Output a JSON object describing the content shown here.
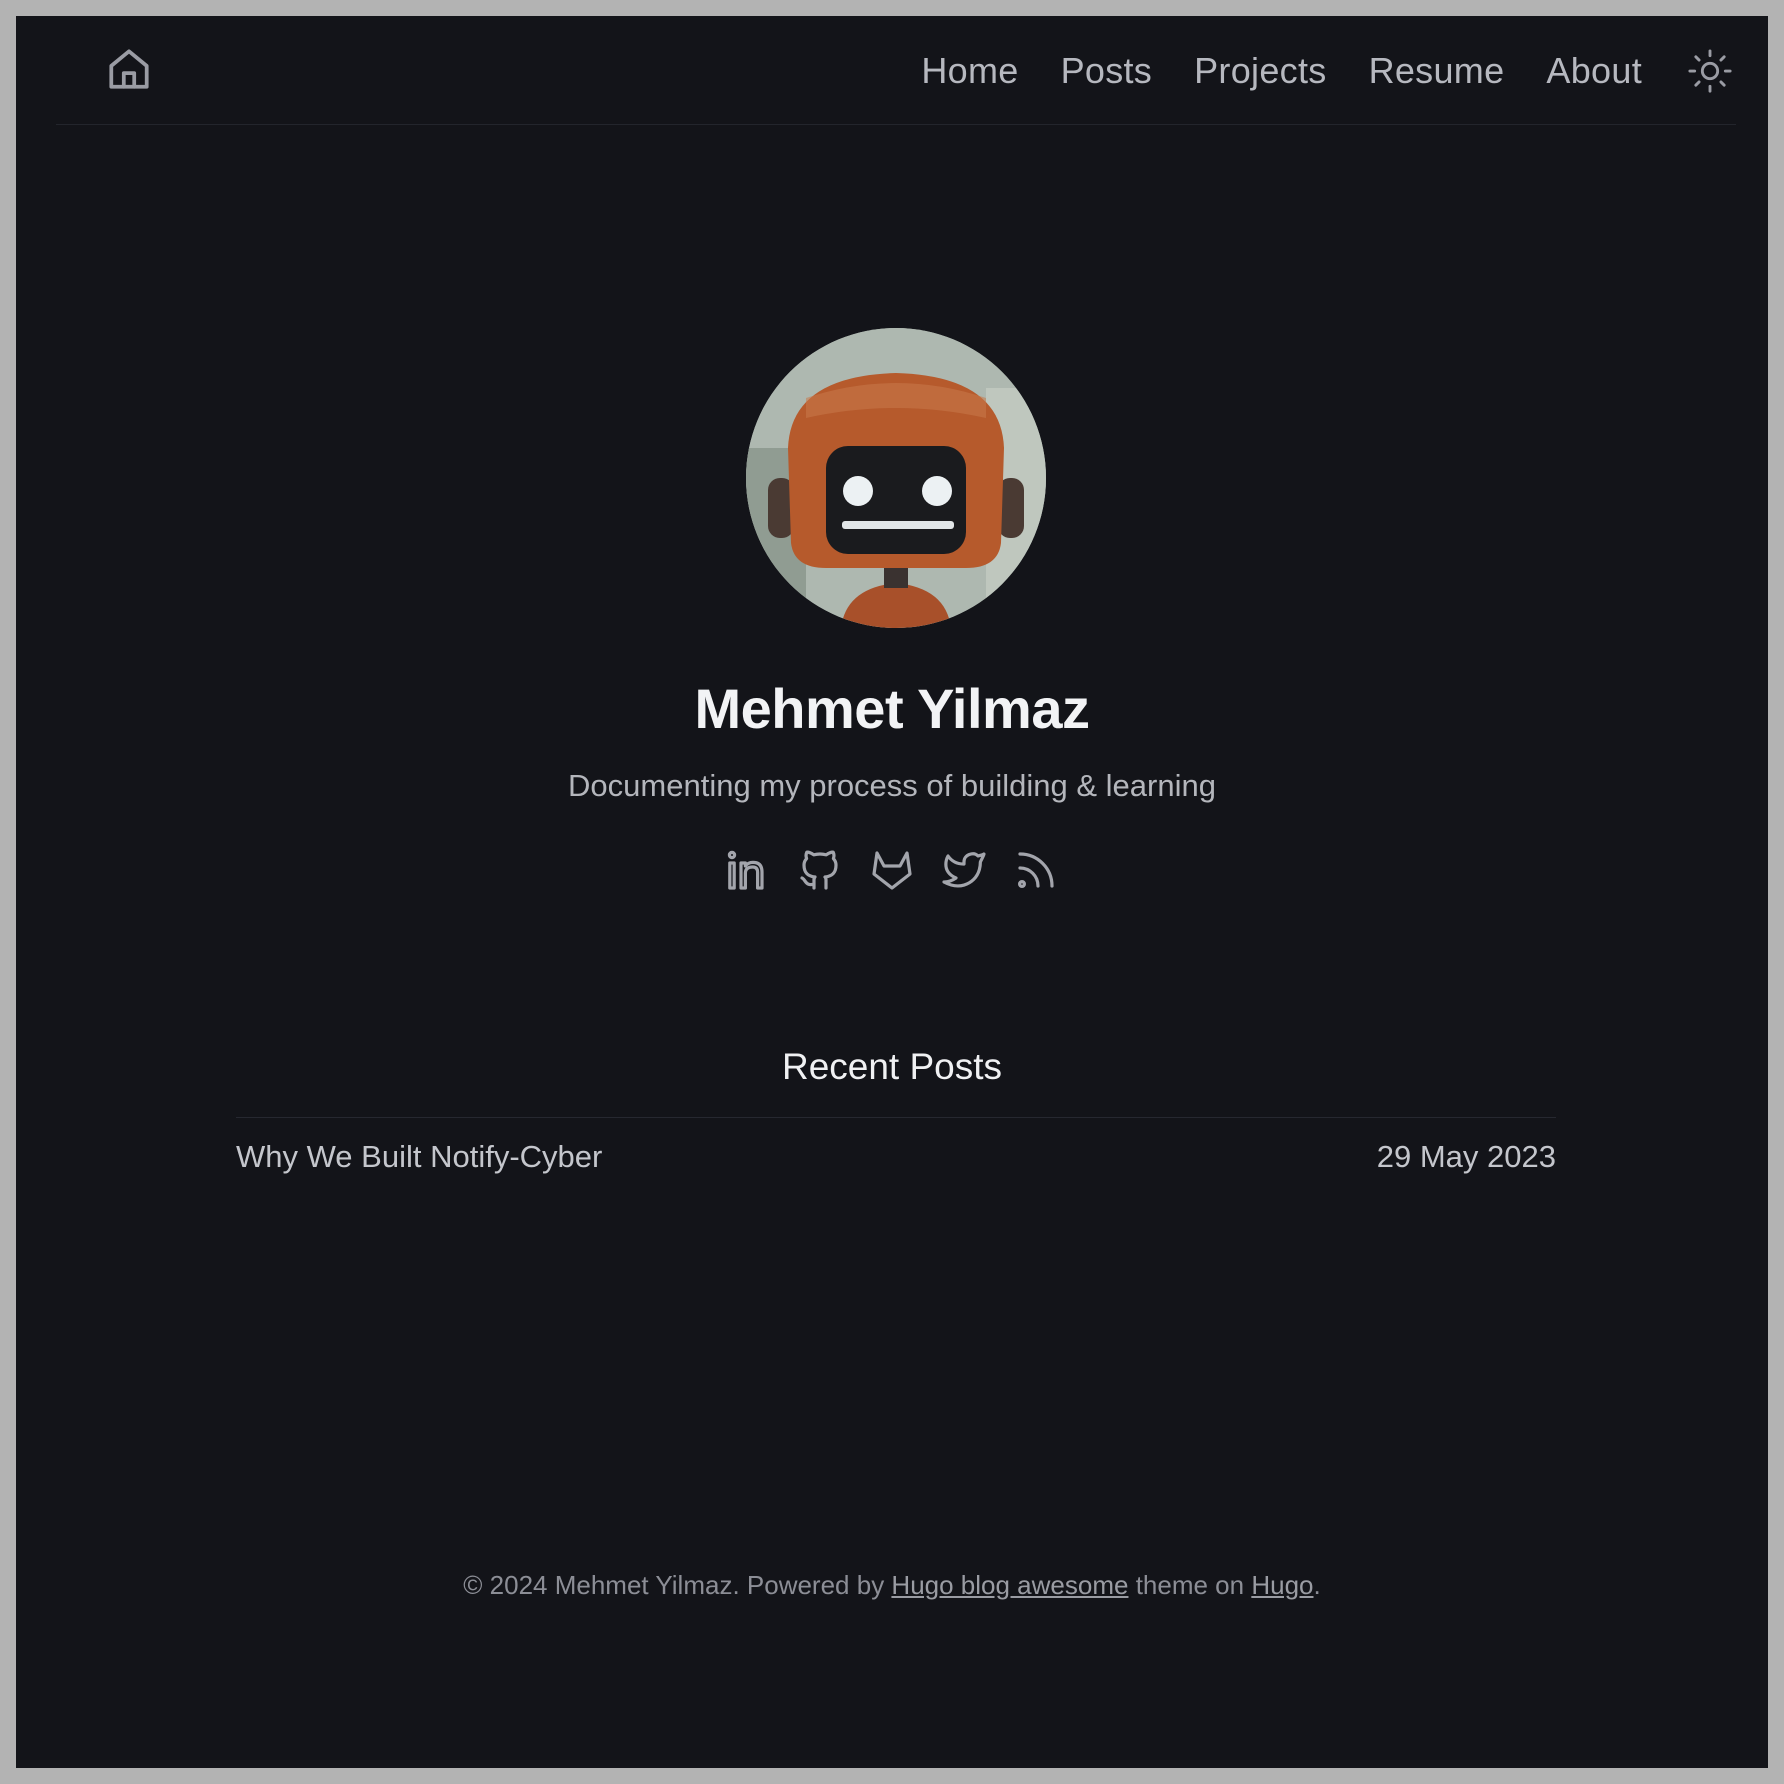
{
  "header": {
    "nav": [
      {
        "label": "Home"
      },
      {
        "label": "Posts"
      },
      {
        "label": "Projects"
      },
      {
        "label": "Resume"
      },
      {
        "label": "About"
      }
    ],
    "home_icon": "home-icon",
    "theme_icon": "sun-icon"
  },
  "hero": {
    "name": "Mehmet Yilmaz",
    "tagline": "Documenting my process of building & learning",
    "socials": [
      {
        "icon": "linkedin-icon"
      },
      {
        "icon": "github-icon"
      },
      {
        "icon": "gitlab-icon"
      },
      {
        "icon": "twitter-icon"
      },
      {
        "icon": "rss-icon"
      }
    ]
  },
  "recent_posts": {
    "title": "Recent Posts",
    "items": [
      {
        "title": "Why We Built Notify-Cyber",
        "date": "29 May 2023"
      }
    ]
  },
  "footer": {
    "prefix": "© 2024 Mehmet Yilmaz. Powered by ",
    "theme_link": "Hugo blog awesome",
    "middle": " theme on ",
    "hugo_link": "Hugo",
    "suffix": "."
  },
  "colors": {
    "background": "#131419",
    "border": "#b3b3b3",
    "text": "#f2f3f5",
    "muted": "#b4b6bc"
  }
}
